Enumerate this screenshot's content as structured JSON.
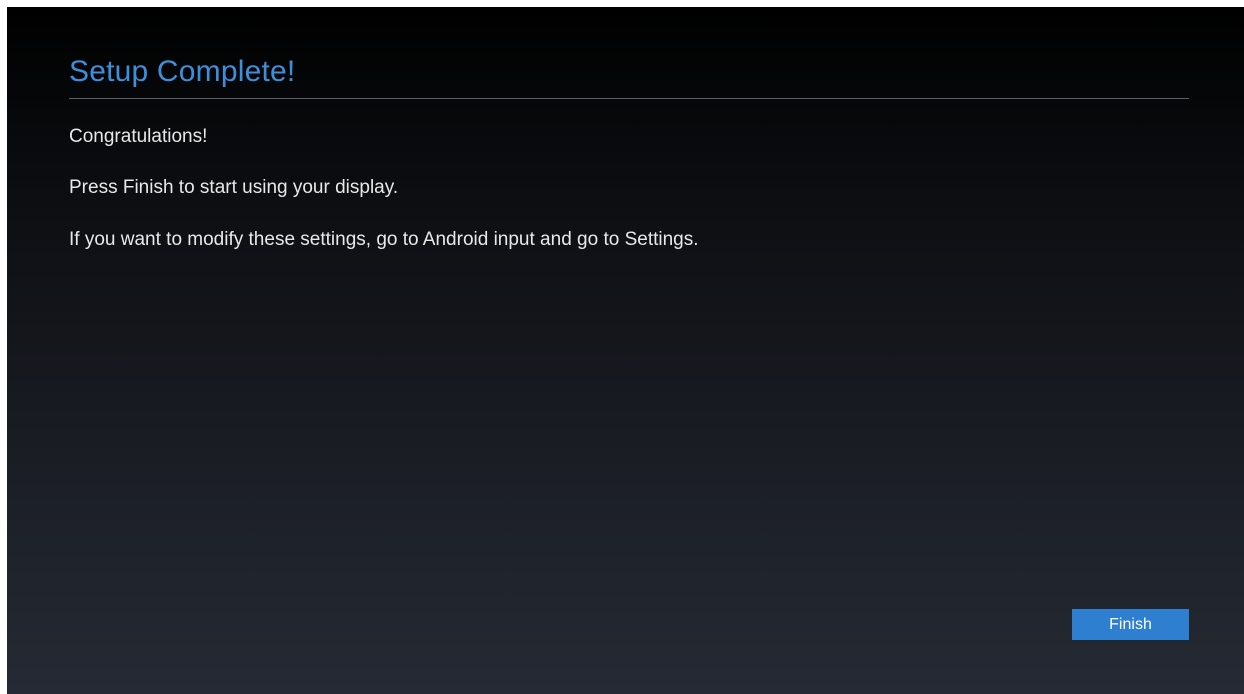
{
  "header": {
    "title": "Setup Complete!"
  },
  "content": {
    "messages": [
      "Congratulations!",
      "Press Finish to start using your display.",
      "If you want to modify these settings, go to Android input and go to Settings."
    ]
  },
  "actions": {
    "finish_label": "Finish"
  },
  "colors": {
    "accent": "#3d8fdc",
    "button": "#2f7fd0",
    "text": "#e8e8e8"
  }
}
